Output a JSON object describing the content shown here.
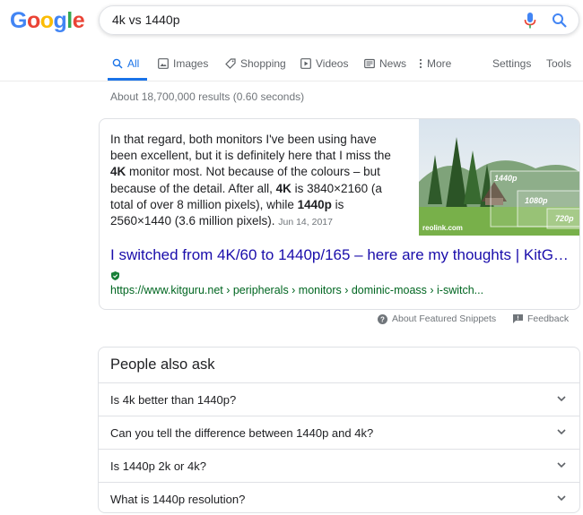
{
  "logo": [
    "G",
    "o",
    "o",
    "g",
    "l",
    "e"
  ],
  "logo_colors": [
    "#4285f4",
    "#ea4335",
    "#fbbc05",
    "#4285f4",
    "#34a853",
    "#ea4335"
  ],
  "search": {
    "query": "4k vs 1440p",
    "mic_icon": "mic-icon",
    "search_icon": "search-icon"
  },
  "tabs": [
    {
      "label": "All",
      "icon": "search-icon",
      "active": true
    },
    {
      "label": "Images",
      "icon": "image-icon"
    },
    {
      "label": "Shopping",
      "icon": "tag-icon"
    },
    {
      "label": "Videos",
      "icon": "play-icon"
    },
    {
      "label": "News",
      "icon": "newspaper-icon"
    },
    {
      "label": "More",
      "icon": "more-vertical-icon"
    },
    {
      "label": "Settings"
    },
    {
      "label": "Tools"
    }
  ],
  "stats": "About 18,700,000 results (0.60 seconds)",
  "featured": {
    "snippet_parts": [
      {
        "text": "In that regard, both monitors I've been using have been excellent, but it is definitely here that I miss the "
      },
      {
        "text": "4K",
        "bold": true
      },
      {
        "text": " monitor most. Not because of the colours – but because of the detail. After all, "
      },
      {
        "text": "4K",
        "bold": true
      },
      {
        "text": " is 3840×2160 (a total of over 8 million pixels), while "
      },
      {
        "text": "1440p",
        "bold": true
      },
      {
        "text": " is 2560×1440 (3.6 million pixels)."
      }
    ],
    "date": "Jun 14, 2017",
    "image_caption": "reolink.com",
    "image_labels": [
      "1440p",
      "1080p",
      "720p"
    ],
    "title": "I switched from 4K/60 to 1440p/165 – here are my thoughts | KitG…",
    "url": "https://www.kitguru.net › peripherals › monitors › dominic-moass › i-switch..."
  },
  "feedback": {
    "about": "About Featured Snippets",
    "feedback": "Feedback"
  },
  "paa": {
    "title": "People also ask",
    "questions": [
      "Is 4k better than 1440p?",
      "Can you tell the difference between 1440p and 4k?",
      "Is 1440p 2k or 4k?",
      "What is 1440p resolution?"
    ]
  },
  "colors": {
    "link": "#1a0dab",
    "url": "#006621",
    "accent": "#1a73e8"
  }
}
